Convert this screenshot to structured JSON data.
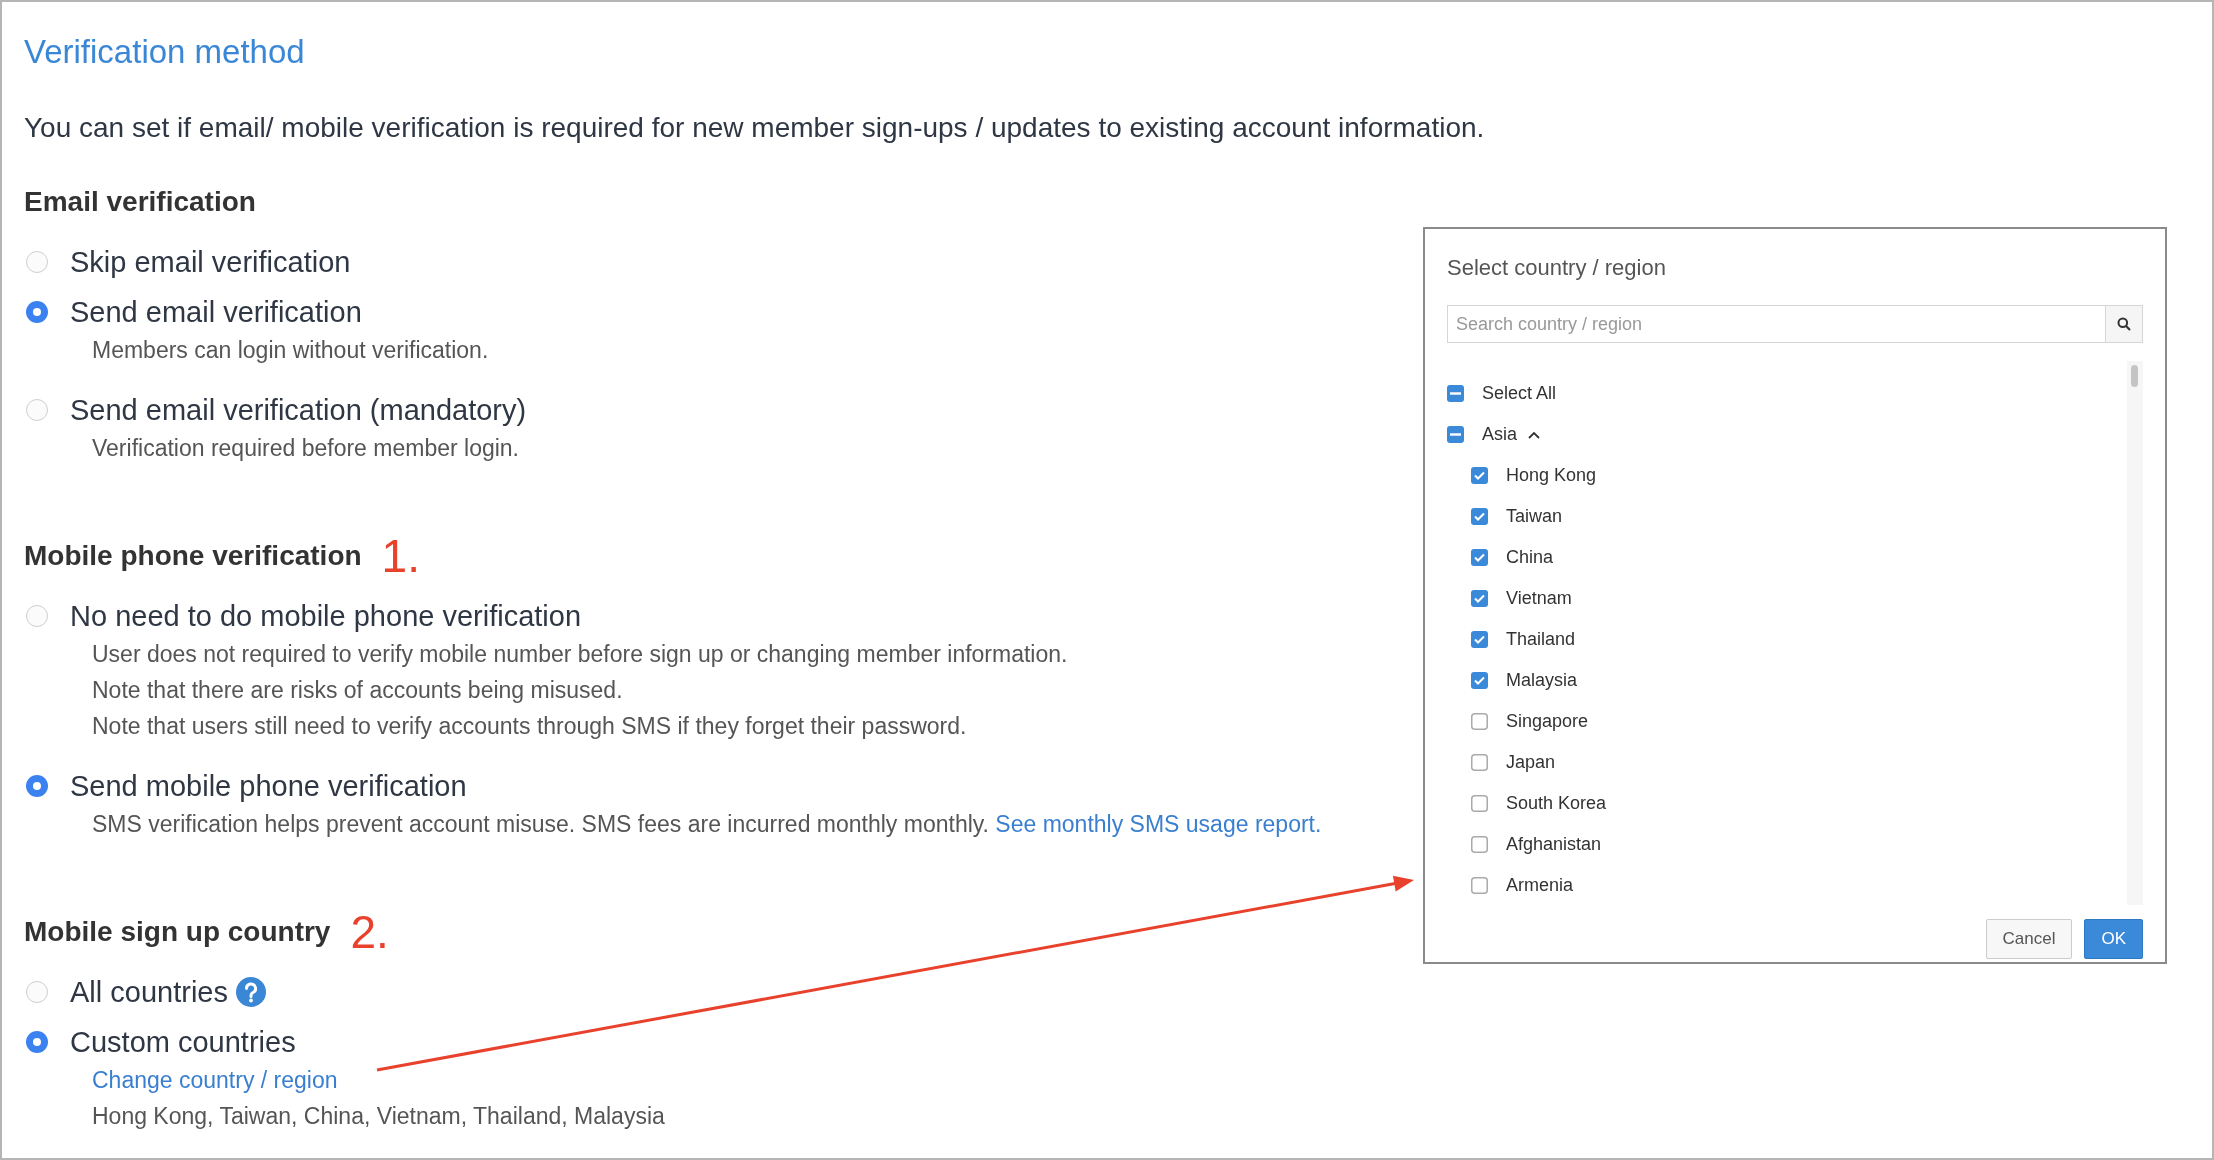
{
  "title": "Verification method",
  "intro": "You can set if email/ mobile verification is required for new member sign-ups / updates to existing account information.",
  "sections": [
    {
      "heading": "Email verification",
      "options": [
        {
          "label": "Skip email verification",
          "selected": false
        },
        {
          "label": "Send email verification",
          "selected": true,
          "description": [
            {
              "text": "Members can login without verification."
            }
          ]
        },
        {
          "label": "Send email verification (mandatory)",
          "selected": false,
          "description": [
            {
              "text": "Verification required before member login."
            }
          ]
        }
      ]
    },
    {
      "heading": "Mobile phone verification",
      "annotation": "1.",
      "options": [
        {
          "label": "No need to do mobile phone verification",
          "selected": false,
          "description": [
            {
              "text": "User does not required to verify mobile number before sign up or changing member information."
            },
            {
              "text": "Note that there are risks of accounts being misused."
            },
            {
              "text": "Note that users still need to verify accounts through SMS if they forget their password."
            }
          ]
        },
        {
          "label": "Send mobile phone verification",
          "selected": true,
          "description": [
            {
              "text": "SMS verification helps prevent account misuse. SMS fees are incurred monthly monthly.",
              "link": "See monthly SMS usage report."
            }
          ]
        }
      ]
    },
    {
      "heading": "Mobile sign up country",
      "annotation": "2.",
      "options": [
        {
          "label": "All countries",
          "selected": false,
          "help_icon": true
        },
        {
          "label": "Custom countries",
          "selected": true,
          "description": [
            {
              "link": "Change country / region"
            },
            {
              "text": "Hong Kong, Taiwan, China, Vietnam, Thailand, Malaysia"
            }
          ]
        }
      ]
    }
  ],
  "dialog": {
    "title": "Select country / region",
    "search": {
      "placeholder": "Search country / region"
    },
    "tree": [
      {
        "label": "Select All",
        "checked": false,
        "partial": true
      },
      {
        "label": "Asia",
        "checked": false,
        "partial": true,
        "expanded": true,
        "children": [
          {
            "label": "Hong Kong",
            "checked": true,
            "partial": false
          },
          {
            "label": "Taiwan",
            "checked": true,
            "partial": false
          },
          {
            "label": "China",
            "checked": true,
            "partial": false
          },
          {
            "label": "Vietnam",
            "checked": true,
            "partial": false
          },
          {
            "label": "Thailand",
            "checked": true,
            "partial": false
          },
          {
            "label": "Malaysia",
            "checked": true,
            "partial": false
          },
          {
            "label": "Singapore",
            "checked": false,
            "partial": false
          },
          {
            "label": "Japan",
            "checked": false,
            "partial": false
          },
          {
            "label": "South Korea",
            "checked": false,
            "partial": false
          },
          {
            "label": "Afghanistan",
            "checked": false,
            "partial": false
          },
          {
            "label": "Armenia",
            "checked": false,
            "partial": false
          }
        ]
      }
    ],
    "buttons": [
      {
        "label": "Cancel",
        "kind": "secondary"
      },
      {
        "label": "OK",
        "kind": "primary"
      }
    ]
  }
}
